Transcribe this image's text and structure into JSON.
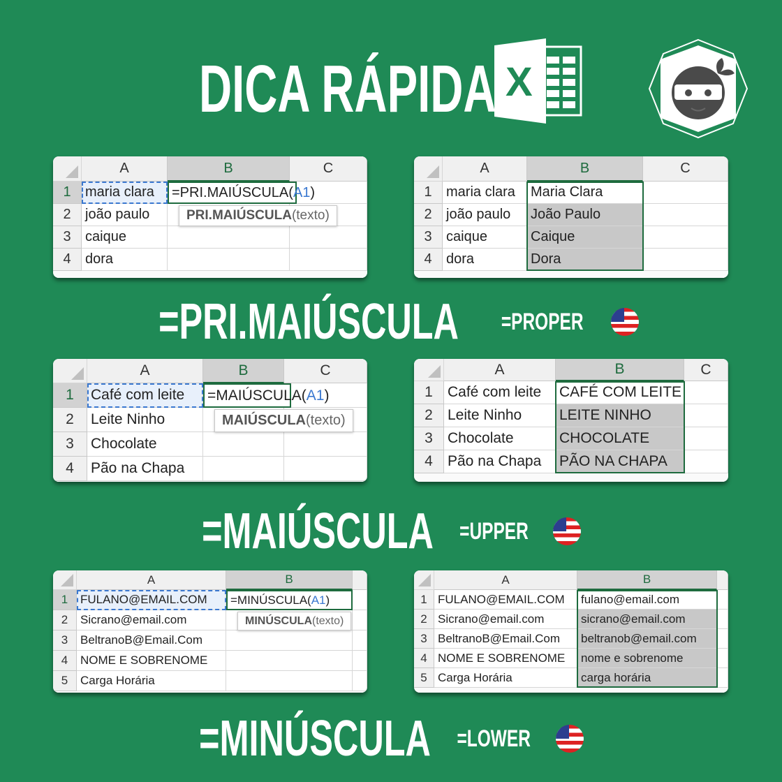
{
  "header": {
    "title": "DICA RÁPIDA",
    "excel_logo_letter": "X",
    "brand_logo": "ninja-icon"
  },
  "colors": {
    "background": "#1f8a56",
    "excel_green": "#1e6b3e",
    "reference_blue": "#3a78d0",
    "fill_grey": "#c8c8c8"
  },
  "sections": [
    {
      "title": "=PRI.MAIÚSCULA",
      "english": "=PROPER",
      "flag": "us-flag-icon"
    },
    {
      "title": "=MAIÚSCULA",
      "english": "=UPPER",
      "flag": "us-flag-icon"
    },
    {
      "title": "=MINÚSCULA",
      "english": "=LOWER",
      "flag": "us-flag-icon"
    }
  ],
  "sheets": [
    {
      "columns": [
        "A",
        "B",
        "C"
      ],
      "row_numbers": [
        "1",
        "2",
        "3",
        "4"
      ],
      "rows": [
        [
          "maria clara",
          "",
          ""
        ],
        [
          "joão paulo",
          "",
          ""
        ],
        [
          "caique",
          "",
          ""
        ],
        [
          "dora",
          "",
          ""
        ]
      ],
      "formula": {
        "prefix": "=PRI.MAIÚSCULA(",
        "ref": "A1",
        "suffix": ")"
      },
      "tooltip": {
        "name": "PRI.MAIÚSCULA",
        "args": "(texto)"
      }
    },
    {
      "columns": [
        "A",
        "B",
        "C"
      ],
      "row_numbers": [
        "1",
        "2",
        "3",
        "4"
      ],
      "rows": [
        [
          "maria clara",
          "Maria Clara",
          ""
        ],
        [
          "joão paulo",
          "João Paulo",
          ""
        ],
        [
          "caique",
          "Caique",
          ""
        ],
        [
          "dora",
          "Dora",
          ""
        ]
      ]
    },
    {
      "columns": [
        "A",
        "B",
        "C"
      ],
      "row_numbers": [
        "1",
        "2",
        "3",
        "4"
      ],
      "rows": [
        [
          "Café com leite",
          "",
          ""
        ],
        [
          "Leite Ninho",
          "",
          ""
        ],
        [
          "Chocolate",
          "",
          ""
        ],
        [
          "Pão na Chapa",
          "",
          ""
        ]
      ],
      "formula": {
        "prefix": "=MAIÚSCULA(",
        "ref": "A1",
        "suffix": ")"
      },
      "tooltip": {
        "name": "MAIÚSCULA",
        "args": "(texto)"
      }
    },
    {
      "columns": [
        "A",
        "B",
        "C"
      ],
      "row_numbers": [
        "1",
        "2",
        "3",
        "4"
      ],
      "rows": [
        [
          "Café com leite",
          "CAFÉ COM LEITE",
          ""
        ],
        [
          "Leite Ninho",
          "LEITE NINHO",
          ""
        ],
        [
          "Chocolate",
          "CHOCOLATE",
          ""
        ],
        [
          "Pão na Chapa",
          "PÃO NA CHAPA",
          ""
        ]
      ]
    },
    {
      "columns": [
        "A",
        "B",
        ""
      ],
      "row_numbers": [
        "1",
        "2",
        "3",
        "4",
        "5"
      ],
      "rows": [
        [
          "FULANO@EMAIL.COM",
          "",
          ""
        ],
        [
          "Sicrano@email.com",
          "",
          ""
        ],
        [
          "BeltranoB@Email.Com",
          "",
          ""
        ],
        [
          "NOME E SOBRENOME",
          "",
          ""
        ],
        [
          "Carga Horária",
          "",
          ""
        ]
      ],
      "formula": {
        "prefix": "=MINÚSCULA(",
        "ref": "A1",
        "suffix": ")"
      },
      "tooltip": {
        "name": "MINÚSCULA",
        "args": "(texto)"
      }
    },
    {
      "columns": [
        "A",
        "B",
        ""
      ],
      "row_numbers": [
        "1",
        "2",
        "3",
        "4",
        "5"
      ],
      "rows": [
        [
          "FULANO@EMAIL.COM",
          "fulano@email.com",
          ""
        ],
        [
          "Sicrano@email.com",
          "sicrano@email.com",
          ""
        ],
        [
          "BeltranoB@Email.Com",
          "beltranob@email.com",
          ""
        ],
        [
          "NOME E SOBRENOME",
          "nome e sobrenome",
          ""
        ],
        [
          "Carga Horária",
          "carga horária",
          ""
        ]
      ]
    }
  ]
}
